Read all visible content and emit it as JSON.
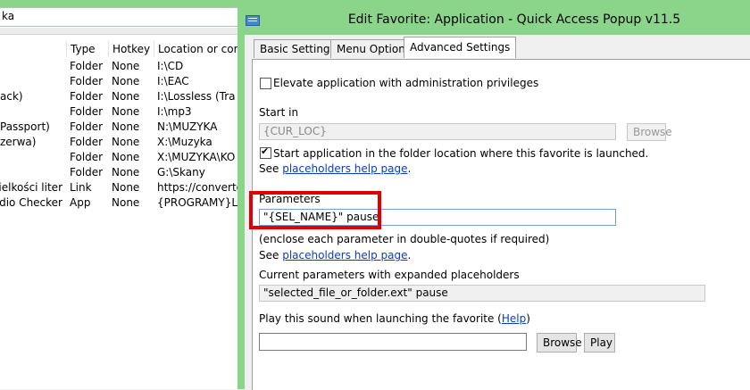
{
  "background_window": {
    "search_text": "ka",
    "columns": [
      "",
      "Type",
      "Hotkey",
      "Location or cont"
    ],
    "rows": [
      {
        "name": "",
        "type": "Folder",
        "hotkey": "None",
        "location": "I:\\CD"
      },
      {
        "name": "",
        "type": "Folder",
        "hotkey": "None",
        "location": "I:\\EAC"
      },
      {
        "name": "ack)",
        "type": "Folder",
        "hotkey": "None",
        "location": "I:\\Lossless (Tra"
      },
      {
        "name": "",
        "type": "Folder",
        "hotkey": "None",
        "location": "I:\\mp3"
      },
      {
        "name": "Passport)",
        "type": "Folder",
        "hotkey": "None",
        "location": "N:\\MUZYKA"
      },
      {
        "name": "zerwa)",
        "type": "Folder",
        "hotkey": "None",
        "location": "X:\\Muzyka"
      },
      {
        "name": "",
        "type": "Folder",
        "hotkey": "None",
        "location": "X:\\MUZYKA\\KO"
      },
      {
        "name": "",
        "type": "Folder",
        "hotkey": "None",
        "location": "G:\\Skany"
      },
      {
        "name": "vielkości liter",
        "type": "Link",
        "hotkey": "None",
        "location": "https://converto"
      },
      {
        "name": "dio Checker",
        "type": "App",
        "hotkey": "None",
        "location": "{PROGRAMY}Lo"
      }
    ]
  },
  "dialog": {
    "title": "Edit Favorite: Application - Quick Access Popup v11.5",
    "tabs": [
      "Basic Settings",
      "Menu Options",
      "Advanced Settings"
    ],
    "elevate_label": "Elevate application with administration privileges",
    "elevate_checked": false,
    "start_in_label": "Start in",
    "start_in_value": "{CUR_LOC}",
    "browse_label": "Browse",
    "start_in_folder_label": "Start application in the folder location where this favorite is launched.",
    "start_in_folder_checked": true,
    "see_label": "See",
    "placeholders_link": "placeholders help page",
    "period": ".",
    "parameters_label": "Parameters",
    "parameters_value": "\"{SEL_NAME}\" pause",
    "parameters_hint": "(enclose each parameter in double-quotes if required)",
    "expanded_label": "Current parameters with expanded placeholders",
    "expanded_value": "\"selected_file_or_folder.ext\" pause",
    "sound_label_prefix": "Play this sound when launching the favorite (",
    "sound_help_link": "Help",
    "sound_label_suffix": ")",
    "sound_value": "",
    "browse2_label": "Browse",
    "play_label": "Play"
  },
  "colors": {
    "title_bar": "#8ad58a",
    "highlight_box": "#e00000",
    "link": "#0a3cc8"
  }
}
